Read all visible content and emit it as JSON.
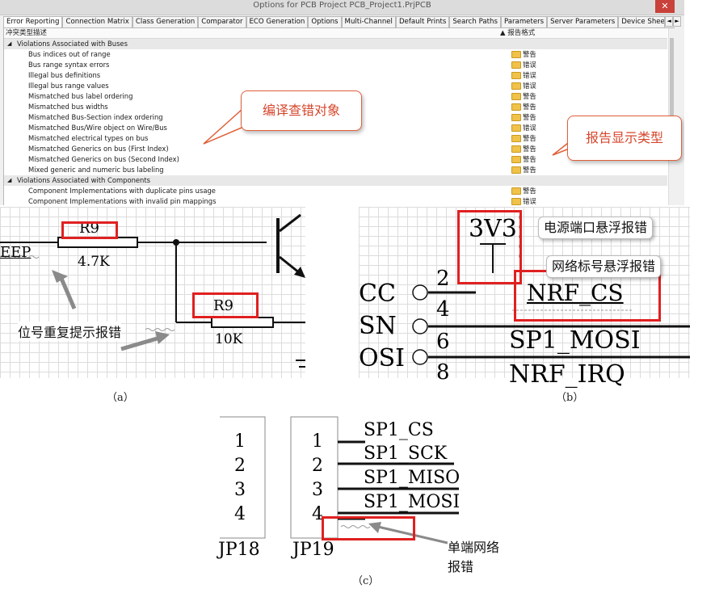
{
  "dialog": {
    "title": "Options for PCB Project PCB_Project1.PrjPCB",
    "close_label": "✕",
    "tabs": [
      "Error Reporting",
      "Connection Matrix",
      "Class Generation",
      "Comparator",
      "ECO Generation",
      "Options",
      "Multi-Channel",
      "Default Prints",
      "Search Paths",
      "Parameters",
      "Server Parameters",
      "Device Sheet"
    ],
    "tab_arrows": [
      "◄",
      "►"
    ],
    "columns": {
      "left": "冲突类型描述",
      "right": "▲ 报告格式"
    },
    "groups": [
      {
        "name": "Violations Associated with Buses",
        "expander": "◢",
        "items": [
          {
            "label": "Bus indices out of range",
            "report": "警告"
          },
          {
            "label": "Bus range syntax errors",
            "report": "错误"
          },
          {
            "label": "Illegal bus definitions",
            "report": "错误"
          },
          {
            "label": "Illegal bus range values",
            "report": "错误"
          },
          {
            "label": "Mismatched bus label ordering",
            "report": "警告"
          },
          {
            "label": "Mismatched bus widths",
            "report": "警告"
          },
          {
            "label": "Mismatched Bus-Section index ordering",
            "report": "警告"
          },
          {
            "label": "Mismatched Bus/Wire object on Wire/Bus",
            "report": "错误"
          },
          {
            "label": "Mismatched electrical types on bus",
            "report": "警告"
          },
          {
            "label": "Mismatched Generics on bus (First Index)",
            "report": "警告"
          },
          {
            "label": "Mismatched Generics on bus (Second Index)",
            "report": "警告"
          },
          {
            "label": "Mixed generic and numeric bus labeling",
            "report": "警告"
          }
        ]
      },
      {
        "name": "Violations Associated with Components",
        "expander": "◢",
        "items": [
          {
            "label": "Component Implementations with duplicate pins usage",
            "report": "警告"
          },
          {
            "label": "Component Implementations with invalid pin mappings",
            "report": "错误"
          }
        ]
      }
    ],
    "callouts": {
      "object": "编译查错对象",
      "type": "报告显示类型"
    }
  },
  "figure_a": {
    "caption": "（a）",
    "net_label": "EEP",
    "r1_designator": "R9",
    "r1_value": "4.7K",
    "r2_designator": "R9",
    "r2_value": "10K",
    "annotation": "位号重复提示报错"
  },
  "figure_b": {
    "caption": "（b）",
    "power_port": "3V3",
    "pin_labels": [
      "CC",
      "SN",
      "OSI"
    ],
    "pin_numbers": [
      "2",
      "4",
      "6",
      "8"
    ],
    "nets": [
      "NRF_CS",
      "SP1_MOSI",
      "NRF_IRQ"
    ],
    "callout_power": "电源端口悬浮报错",
    "callout_net": "网络标号悬浮报错"
  },
  "figure_c": {
    "caption": "（c）",
    "jp18_pins": [
      "1",
      "2",
      "3",
      "4"
    ],
    "jp18_label": "JP18",
    "jp19_pins": [
      "1",
      "2",
      "3",
      "4"
    ],
    "jp19_label": "JP19",
    "nets": [
      "SP1_CS",
      "SP1_SCK",
      "SP1_MISO",
      "SP1_MOSI"
    ],
    "annotation": "单端网络报错"
  },
  "colors": {
    "error_box": "#e02020",
    "callout_text": "#d6462c",
    "folder": "#f0c24a"
  }
}
